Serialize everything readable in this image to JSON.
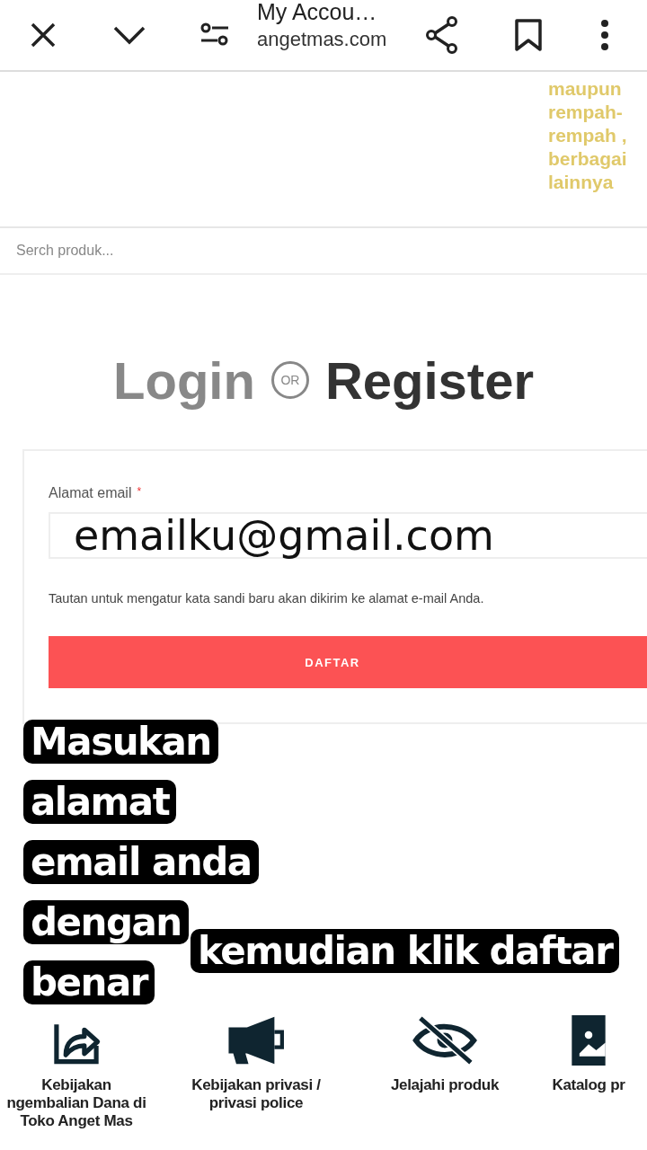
{
  "browser_bar": {
    "title": "My Accou…",
    "domain": "angetmas.com"
  },
  "promo_text": [
    "maupun",
    "rempah-",
    "rempah ,",
    "berbagai",
    "lainnya"
  ],
  "search": {
    "placeholder": "Serch produk..."
  },
  "heading": {
    "login": "Login",
    "or": "OR",
    "register": "Register"
  },
  "form": {
    "label": "Alamat email",
    "required_mark": "*",
    "email_value": "emailku@gmail.com",
    "hint": "Tautan untuk mengatur kata sandi baru akan dikirim ke alamat e-mail Anda.",
    "button": "DAFTAR"
  },
  "captions": [
    {
      "lines": [
        "Masukan",
        "alamat",
        "email anda",
        "dengan",
        "benar"
      ]
    },
    {
      "lines": [
        "kemudian klik daftar"
      ]
    }
  ],
  "footer_links": [
    {
      "kind": "refund",
      "lines": [
        "Kebijakan",
        "ngembalian Dana di",
        "Toko Anget Mas"
      ]
    },
    {
      "kind": "privacy",
      "lines": [
        "Kebijakan privasi /",
        "privasi police"
      ]
    },
    {
      "kind": "explore",
      "lines": [
        "Jelajahi produk"
      ]
    },
    {
      "kind": "catalog",
      "lines": [
        "Katalog pr"
      ]
    }
  ]
}
